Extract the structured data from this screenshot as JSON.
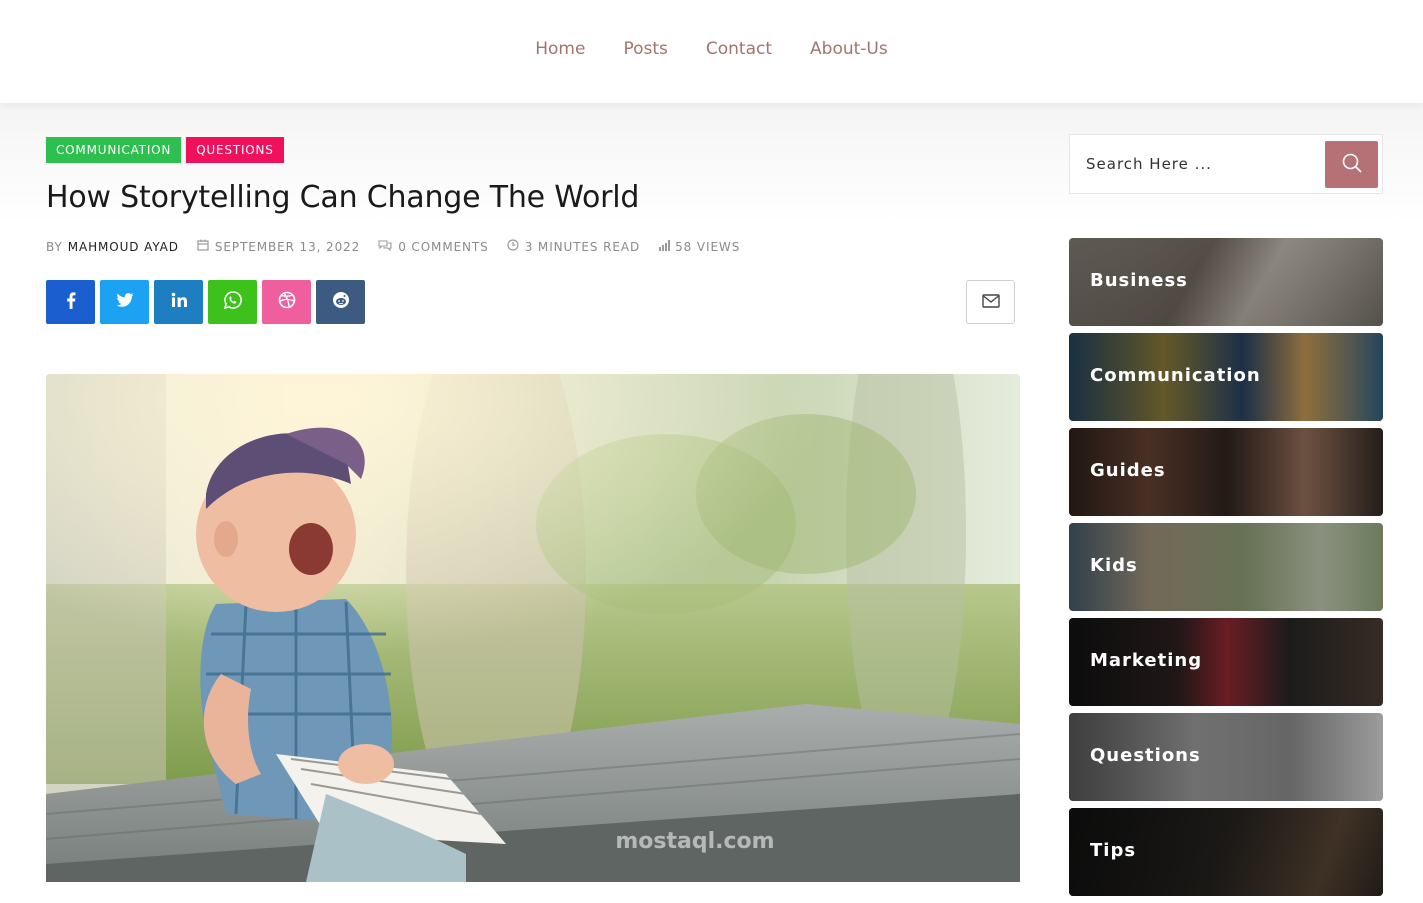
{
  "nav": {
    "items": [
      {
        "label": "Home"
      },
      {
        "label": "Posts"
      },
      {
        "label": "Contact"
      },
      {
        "label": "About-Us"
      }
    ]
  },
  "post": {
    "tags": [
      {
        "label": "COMMUNICATION",
        "color": "#2ec04f"
      },
      {
        "label": "QUESTIONS",
        "color": "#f0105c"
      }
    ],
    "title": "How Storytelling Can Change The World",
    "meta": {
      "by_label": "BY",
      "author": "MAHMOUD AYAD",
      "date": "SEPTEMBER 13, 2022",
      "comments": "0 COMMENTS",
      "read_time": "3 MINUTES READ",
      "views": "58 VIEWS"
    },
    "share_buttons": [
      {
        "network": "facebook",
        "icon": "facebook-icon",
        "color": "#1a5ecf"
      },
      {
        "network": "twitter",
        "icon": "twitter-icon",
        "color": "#1da1f2"
      },
      {
        "network": "linkedin",
        "icon": "linkedin-icon",
        "color": "#1e7ec2"
      },
      {
        "network": "whatsapp",
        "icon": "whatsapp-icon",
        "color": "#3cc21a"
      },
      {
        "network": "dribbble",
        "icon": "dribbble-icon",
        "color": "#ef5f9e"
      },
      {
        "network": "reddit",
        "icon": "reddit-icon",
        "color": "#3d5a80"
      }
    ],
    "email_icon": "envelope-icon",
    "hero_watermark": "mostaql.com"
  },
  "sidebar": {
    "search": {
      "placeholder": "Search Here ...",
      "button_color": "#b57176"
    },
    "categories": [
      {
        "label": "Business"
      },
      {
        "label": "Communication"
      },
      {
        "label": "Guides"
      },
      {
        "label": "Kids"
      },
      {
        "label": "Marketing"
      },
      {
        "label": "Questions"
      },
      {
        "label": "Tips"
      }
    ]
  }
}
